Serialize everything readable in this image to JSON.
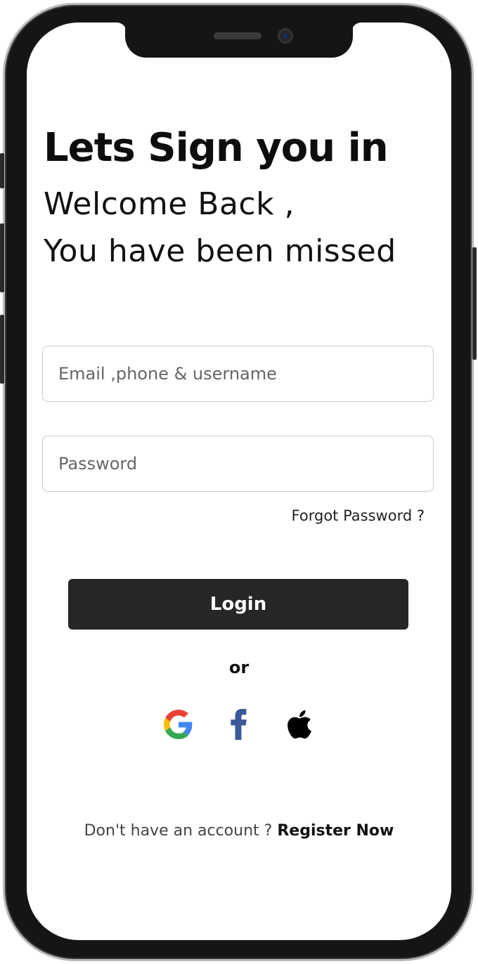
{
  "header": {
    "title": "Lets Sign you in",
    "subtitle_line1": "Welcome Back ,",
    "subtitle_line2": "You have been missed"
  },
  "form": {
    "email_placeholder": "Email ,phone & username",
    "email_value": "",
    "password_placeholder": "Password",
    "password_value": "",
    "forgot_label": "Forgot Password ?",
    "login_label": "Login"
  },
  "divider": {
    "label": "or"
  },
  "social": {
    "items": [
      {
        "name": "google",
        "icon": "google-icon"
      },
      {
        "name": "facebook",
        "icon": "facebook-icon",
        "color": "#3b5998"
      },
      {
        "name": "apple",
        "icon": "apple-icon",
        "color": "#000000"
      }
    ]
  },
  "footer": {
    "prompt": "Don't have an account ? ",
    "register_label": "Register Now"
  },
  "colors": {
    "button_bg": "#262626",
    "text": "#111111",
    "field_border": "#c9c9c9"
  }
}
